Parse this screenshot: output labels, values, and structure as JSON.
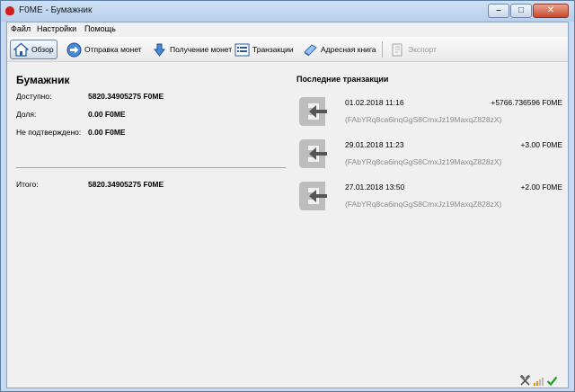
{
  "window": {
    "title": "F0ME - Бумажник"
  },
  "menu": {
    "items": [
      "Файл",
      "Настройки",
      "Помощь"
    ]
  },
  "toolbar": {
    "overview": "Обзор",
    "send": "Отправка монет",
    "receive": "Получение монет",
    "transactions": "Транзакции",
    "addressbook": "Адресная книга",
    "export": "Экспорт"
  },
  "wallet": {
    "heading": "Бумажник",
    "available_label": "Доступно:",
    "available_value": "5820.34905275 F0ME",
    "stake_label": "Доля:",
    "stake_value": "0.00 F0ME",
    "unconfirmed_label": "Не подтверждено:",
    "unconfirmed_value": "0.00 F0ME",
    "total_label": "Итого:",
    "total_value": "5820.34905275 F0ME"
  },
  "recent": {
    "heading": "Последние транзакции",
    "transactions": [
      {
        "date": "01.02.2018 11:16",
        "amount": "+5766.736596 F0ME",
        "address": "(FAbYRq8ca6inqGgS8CmxJz19MaxqZ828zX)"
      },
      {
        "date": "29.01.2018 11:23",
        "amount": "+3.00 F0ME",
        "address": "(FAbYRq8ca6inqGgS8CmxJz19MaxqZ828zX)"
      },
      {
        "date": "27.01.2018 13:50",
        "amount": "+2.00 F0ME",
        "address": "(FAbYRq8ca6inqGgS8CmxJz19MaxqZ828zX)"
      }
    ]
  },
  "status": {
    "icons": [
      "staking-hammer-icon",
      "network-signal-icon",
      "synced-check-icon"
    ]
  },
  "colors": {
    "accent": "#1a5fb4",
    "amount_text": "#000000",
    "address_text": "#8a8a8a"
  }
}
